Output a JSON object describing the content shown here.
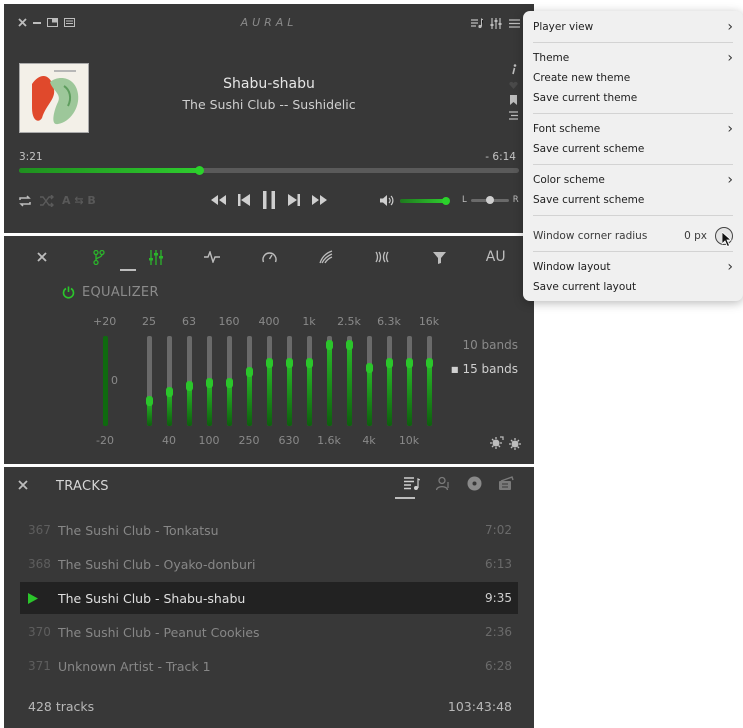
{
  "player": {
    "logo": "AURAL",
    "title": "Shabu-shabu",
    "artist_album": "The Sushi Club -- Sushidelic",
    "time_elapsed": "3:21",
    "time_remaining": "- 6:14",
    "progress_fraction": 0.36,
    "ab_label": "A ⇆ B",
    "volume_fraction": 1.0,
    "pan_left": "L",
    "pan_right": "R",
    "pan_fraction": 0.5,
    "icons": [
      "close-icon",
      "minimize-icon",
      "layout-icon",
      "playlist-icon",
      "playlist-icon",
      "effects-icon",
      "menu-icon",
      "info-icon",
      "favorite-icon",
      "bookmark-icon",
      "chapters-icon",
      "repeat-icon",
      "shuffle-icon",
      "seek-backward-icon",
      "previous-icon",
      "pause-icon",
      "next-icon",
      "seek-forward-icon",
      "volume-icon"
    ]
  },
  "effects": {
    "tab_au_label": "AU",
    "eq_label": "EQUALIZER",
    "preamp_top": "+20",
    "preamp_zero": "0",
    "preamp_bottom": "-20",
    "bands_top_labels": [
      "25",
      "63",
      "160",
      "400",
      "1k",
      "2.5k",
      "6.3k",
      "16k"
    ],
    "bands_bottom_labels": [
      "40",
      "100",
      "250",
      "630",
      "1.6k",
      "4k",
      "10k"
    ],
    "band_levels": [
      0.28,
      0.38,
      0.45,
      0.48,
      0.48,
      0.6,
      0.7,
      0.7,
      0.7,
      0.9,
      0.9,
      0.65,
      0.7,
      0.7,
      0.7
    ],
    "preamp_level": 1.0,
    "bands_10_label": "10 bands",
    "bands_15_label": "15 bands",
    "bands_15_mark": "■"
  },
  "tracks": {
    "title": "TRACKS",
    "rows": [
      {
        "num": "367",
        "name": "The Sushi Club - Tonkatsu",
        "dur": "7:02",
        "playing": false
      },
      {
        "num": "368",
        "name": "The Sushi Club - Oyako-donburi",
        "dur": "6:13",
        "playing": false
      },
      {
        "num": "",
        "name": "The Sushi Club - Shabu-shabu",
        "dur": "9:35",
        "playing": true
      },
      {
        "num": "370",
        "name": "The Sushi Club - Peanut Cookies",
        "dur": "2:36",
        "playing": false
      },
      {
        "num": "371",
        "name": "Unknown Artist - Track 1",
        "dur": "6:28",
        "playing": false
      }
    ],
    "count": "428 tracks",
    "total": "103:43:48"
  },
  "menu": {
    "player_view": "Player view",
    "theme": "Theme",
    "create_theme": "Create new theme",
    "save_theme": "Save current theme",
    "font_scheme": "Font scheme",
    "save_font_scheme": "Save current scheme",
    "color_scheme": "Color scheme",
    "save_color_scheme": "Save current scheme",
    "corner_radius": "Window corner radius",
    "corner_radius_value": "0 px",
    "window_layout": "Window layout",
    "save_layout": "Save current layout",
    "chevron": "›"
  },
  "colors": {
    "panel_bg": "#383838",
    "accent": "#2bd22b",
    "playing_row_bg": "#222222",
    "menu_bg": "#f0f0f0"
  }
}
